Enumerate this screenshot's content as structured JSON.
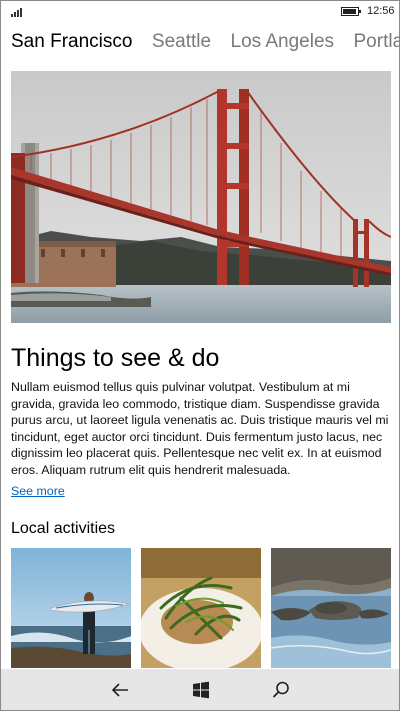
{
  "status": {
    "time": "12:56",
    "battery_level": 0.9
  },
  "pivot": {
    "items": [
      "San Francisco",
      "Seattle",
      "Los Angeles",
      "Portland"
    ],
    "active_index": 0
  },
  "hero": {
    "icon": "golden-gate-bridge-image"
  },
  "section": {
    "title": "Things to see & do",
    "body": "Nullam euismod tellus quis pulvinar volutpat. Vestibulum at mi gravida, gravida leo commodo, tristique diam. Suspendisse gravida purus arcu, ut laoreet ligula venenatis ac. Duis tristique mauris vel mi tincidunt, eget auctor orci tincidunt. Duis fermentum justo lacus, nec dignissim leo placerat quis. Pellentesque nec velit ex. In at euismod eros. Aliquam rutrum elit quis hendrerit malesuada.",
    "see_more": "See more"
  },
  "local": {
    "title": "Local activities",
    "items": [
      "surfer-image",
      "food-image",
      "seals-image"
    ]
  },
  "navbar": {
    "back_icon": "back-arrow-icon",
    "home_icon": "windows-logo-icon",
    "search_icon": "search-icon"
  }
}
